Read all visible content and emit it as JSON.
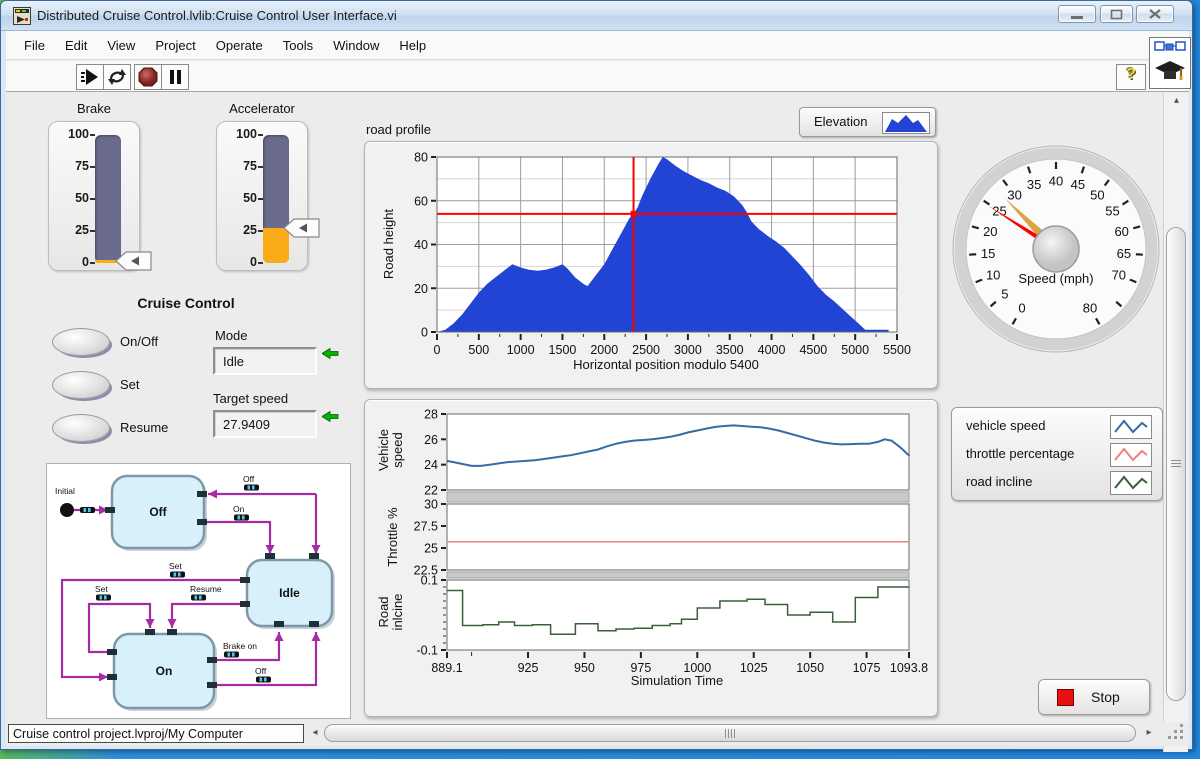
{
  "window": {
    "title": "Distributed Cruise Control.lvlib:Cruise Control User Interface.vi"
  },
  "menu": {
    "items": [
      "File",
      "Edit",
      "View",
      "Project",
      "Operate",
      "Tools",
      "Window",
      "Help"
    ]
  },
  "toolbar": {
    "help_glyph": "?"
  },
  "sliders": {
    "brake": {
      "label": "Brake",
      "value": 1.5,
      "min": 0,
      "max": 100,
      "scale": [
        100,
        75,
        50,
        25,
        0
      ],
      "fill_color": "#fbab18"
    },
    "accelerator": {
      "label": "Accelerator",
      "value": 27,
      "min": 0,
      "max": 100,
      "scale": [
        100,
        75,
        50,
        25,
        0
      ],
      "fill_color": "#fbab18"
    }
  },
  "cruise": {
    "title": "Cruise Control",
    "buttons": [
      {
        "label": "On/Off"
      },
      {
        "label": "Set"
      },
      {
        "label": "Resume"
      }
    ],
    "mode": {
      "label": "Mode",
      "value": "Idle"
    },
    "target_speed": {
      "label": "Target speed",
      "value": "27.9409"
    }
  },
  "statechart": {
    "initial_label": "Initial",
    "states": [
      "Off",
      "Idle",
      "On"
    ],
    "transitions": [
      "Off",
      "On",
      "Set",
      "Set",
      "Resume",
      "Brake on",
      "Off"
    ],
    "state_fill": "#d8f0fa",
    "line_color": "#a42ca4"
  },
  "gauge": {
    "title": "Speed (mph)",
    "min": 0,
    "max": 80,
    "labels": [
      0,
      5,
      10,
      15,
      20,
      25,
      30,
      35,
      40,
      45,
      50,
      55,
      60,
      65,
      70,
      80
    ],
    "needles": [
      {
        "name": "current-speed",
        "value": 24.7,
        "color": "#ff0000"
      },
      {
        "name": "target-speed",
        "value": 27.94,
        "color": "#e0a23e"
      }
    ]
  },
  "road_profile_legend": {
    "label": "Elevation",
    "color": "#2343d7"
  },
  "waveform_legend": {
    "items": [
      {
        "label": "vehicle speed",
        "color": "#356ca5"
      },
      {
        "label": "throttle percentage",
        "color": "#f08080"
      },
      {
        "label": "road incline",
        "color": "#3a5f3a"
      }
    ]
  },
  "stop_button": {
    "label": "Stop",
    "icon_color": "#e81111"
  },
  "status_bar": {
    "project_path": "Cruise control project.lvproj/My Computer"
  },
  "waveform_axis": {
    "xlabel": "Simulation Time",
    "xlim": [
      889.1,
      1093.8
    ],
    "xticks": [
      889.1,
      925,
      950,
      975,
      1000,
      1025,
      1050,
      1075,
      1093.8
    ],
    "minor_xticks": [
      900
    ]
  },
  "chart_data": [
    {
      "id": "road_profile",
      "type": "area",
      "title": "road profile",
      "xlabel": "Horizontal position modulo 5400",
      "ylabel": "Road height",
      "xlim": [
        0,
        5500
      ],
      "ylim": [
        0,
        80
      ],
      "xticks": [
        0,
        500,
        1000,
        1500,
        2000,
        2500,
        3000,
        3500,
        4000,
        4500,
        5000,
        5500
      ],
      "yticks": [
        0,
        20,
        40,
        60,
        80
      ],
      "grid": true,
      "legend": "Elevation",
      "color": "#2244d4",
      "cursor": {
        "x": 2350,
        "y": 54,
        "color": "#ff0000"
      },
      "points": [
        [
          0,
          0
        ],
        [
          100,
          1
        ],
        [
          200,
          4
        ],
        [
          300,
          8
        ],
        [
          400,
          13
        ],
        [
          500,
          18
        ],
        [
          600,
          22
        ],
        [
          700,
          25
        ],
        [
          800,
          28
        ],
        [
          900,
          31
        ],
        [
          1000,
          29.5
        ],
        [
          1100,
          28.5
        ],
        [
          1200,
          28
        ],
        [
          1300,
          28.5
        ],
        [
          1400,
          29.5
        ],
        [
          1500,
          31
        ],
        [
          1560,
          29
        ],
        [
          1650,
          25
        ],
        [
          1750,
          22
        ],
        [
          1800,
          21
        ],
        [
          1900,
          26
        ],
        [
          2000,
          31
        ],
        [
          2100,
          38
        ],
        [
          2200,
          45
        ],
        [
          2300,
          52
        ],
        [
          2350,
          54
        ],
        [
          2400,
          57
        ],
        [
          2450,
          62
        ],
        [
          2550,
          70
        ],
        [
          2650,
          77
        ],
        [
          2700,
          80
        ],
        [
          2750,
          79
        ],
        [
          2850,
          76
        ],
        [
          2950,
          73.5
        ],
        [
          3050,
          71.5
        ],
        [
          3150,
          69.5
        ],
        [
          3250,
          68
        ],
        [
          3350,
          66
        ],
        [
          3450,
          64.5
        ],
        [
          3550,
          62
        ],
        [
          3650,
          58
        ],
        [
          3700,
          55
        ],
        [
          3760,
          50.5
        ],
        [
          3850,
          47
        ],
        [
          3950,
          44
        ],
        [
          4050,
          41.5
        ],
        [
          4150,
          38.5
        ],
        [
          4250,
          34.5
        ],
        [
          4350,
          30.5
        ],
        [
          4450,
          26
        ],
        [
          4550,
          21
        ],
        [
          4650,
          17
        ],
        [
          4750,
          14
        ],
        [
          4850,
          10.5
        ],
        [
          4950,
          7
        ],
        [
          5050,
          3.5
        ],
        [
          5120,
          1
        ],
        [
          5250,
          1
        ],
        [
          5400,
          1
        ]
      ]
    },
    {
      "id": "vehicle_speed",
      "type": "line",
      "ylabel": "Vehicle speed",
      "ylim": [
        22,
        28
      ],
      "yticks": [
        28,
        26,
        24,
        22
      ],
      "color": "#356ca5",
      "points": [
        [
          889,
          24.3
        ],
        [
          892,
          24.2
        ],
        [
          896,
          24.05
        ],
        [
          900,
          23.9
        ],
        [
          904,
          23.9
        ],
        [
          908,
          24.0
        ],
        [
          912,
          24.1
        ],
        [
          916,
          24.2
        ],
        [
          920,
          24.25
        ],
        [
          924,
          24.3
        ],
        [
          928,
          24.35
        ],
        [
          932,
          24.45
        ],
        [
          936,
          24.55
        ],
        [
          940,
          24.65
        ],
        [
          944,
          24.75
        ],
        [
          948,
          24.9
        ],
        [
          952,
          25.05
        ],
        [
          956,
          25.2
        ],
        [
          960,
          25.45
        ],
        [
          964,
          25.65
        ],
        [
          968,
          25.8
        ],
        [
          972,
          25.9
        ],
        [
          976,
          25.95
        ],
        [
          980,
          26.0
        ],
        [
          984,
          26.1
        ],
        [
          988,
          26.2
        ],
        [
          992,
          26.35
        ],
        [
          996,
          26.55
        ],
        [
          1000,
          26.7
        ],
        [
          1004,
          26.85
        ],
        [
          1008,
          26.98
        ],
        [
          1012,
          27.05
        ],
        [
          1016,
          27.1
        ],
        [
          1020,
          27.05
        ],
        [
          1024,
          27.0
        ],
        [
          1028,
          26.95
        ],
        [
          1032,
          26.85
        ],
        [
          1036,
          26.7
        ],
        [
          1040,
          26.5
        ],
        [
          1044,
          26.3
        ],
        [
          1048,
          26.1
        ],
        [
          1052,
          25.9
        ],
        [
          1056,
          25.75
        ],
        [
          1060,
          25.65
        ],
        [
          1064,
          25.6
        ],
        [
          1068,
          25.62
        ],
        [
          1072,
          25.65
        ],
        [
          1076,
          25.65
        ],
        [
          1080,
          25.8
        ],
        [
          1083,
          26.0
        ],
        [
          1086,
          25.9
        ],
        [
          1089,
          25.5
        ],
        [
          1091,
          25.2
        ],
        [
          1093,
          24.85
        ],
        [
          1094,
          24.7
        ]
      ]
    },
    {
      "id": "throttle",
      "type": "line",
      "ylabel": "Throttle %",
      "ylim": [
        22.5,
        30
      ],
      "yticks": [
        30,
        27.5,
        25,
        22.5
      ],
      "color": "#f08080",
      "points": [
        [
          889.1,
          25.7
        ],
        [
          1093.8,
          25.7
        ]
      ]
    },
    {
      "id": "road_incline",
      "type": "line",
      "ylabel": "Road inlcine",
      "ylim": [
        -0.1,
        0.1
      ],
      "yticks": [
        0.1,
        -0.1
      ],
      "minor_ytick_step": 0.02,
      "color": "#3a5f3a",
      "points": [
        [
          889,
          0.07
        ],
        [
          896,
          0.07
        ],
        [
          896,
          -0.03
        ],
        [
          905,
          -0.03
        ],
        [
          905,
          -0.028
        ],
        [
          912,
          -0.028
        ],
        [
          912,
          -0.02
        ],
        [
          919,
          -0.02
        ],
        [
          919,
          -0.03
        ],
        [
          927,
          -0.03
        ],
        [
          927,
          -0.028
        ],
        [
          935,
          -0.028
        ],
        [
          935,
          -0.055
        ],
        [
          946,
          -0.055
        ],
        [
          946,
          -0.025
        ],
        [
          956,
          -0.025
        ],
        [
          956,
          -0.045
        ],
        [
          964,
          -0.045
        ],
        [
          964,
          -0.04
        ],
        [
          972,
          -0.04
        ],
        [
          972,
          -0.038
        ],
        [
          980,
          -0.038
        ],
        [
          980,
          -0.03
        ],
        [
          988,
          -0.03
        ],
        [
          988,
          -0.025
        ],
        [
          993,
          -0.025
        ],
        [
          993,
          -0.012
        ],
        [
          1000,
          -0.012
        ],
        [
          1000,
          0.02
        ],
        [
          1010,
          0.02
        ],
        [
          1010,
          0.04
        ],
        [
          1022,
          0.04
        ],
        [
          1022,
          0.045
        ],
        [
          1030,
          0.045
        ],
        [
          1030,
          0.03
        ],
        [
          1040,
          0.03
        ],
        [
          1040,
          0.0
        ],
        [
          1050,
          0.0
        ],
        [
          1050,
          0.008
        ],
        [
          1060,
          0.008
        ],
        [
          1060,
          -0.02
        ],
        [
          1070,
          -0.02
        ],
        [
          1070,
          0.05
        ],
        [
          1080,
          0.05
        ],
        [
          1080,
          0.08
        ],
        [
          1094,
          0.08
        ]
      ]
    }
  ]
}
